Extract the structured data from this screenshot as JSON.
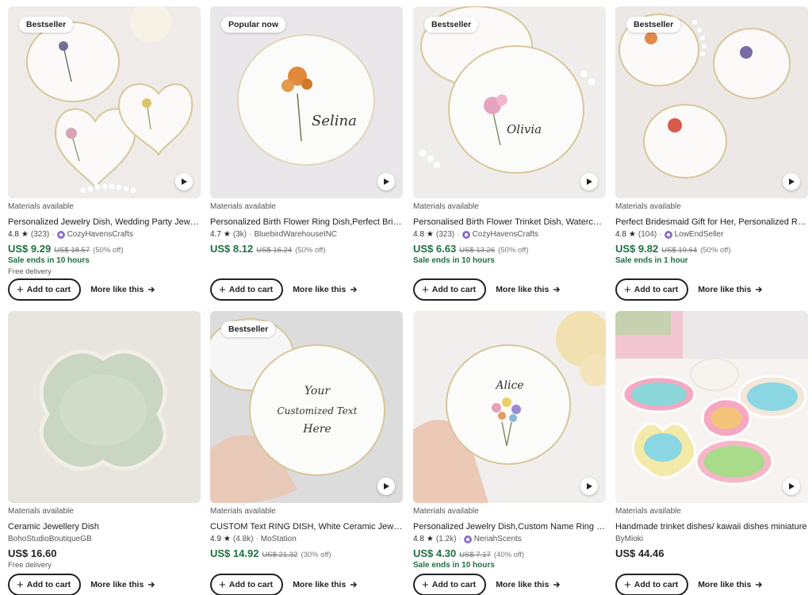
{
  "common": {
    "add_to_cart": "Add to cart",
    "more_like_this": "More like this"
  },
  "products": [
    {
      "badge": "Bestseller",
      "materials": "Materials available",
      "title": "Personalized Jewelry Dish, Wedding Party Jewelry Dish",
      "rating": "4.8",
      "reviews": "(323)",
      "shop": "CozyHavensCrafts",
      "star_seller": true,
      "price": "US$ 9.29",
      "original": "US$ 18.57",
      "discount": "(50% off)",
      "sale": "Sale ends in 10 hours",
      "delivery": "Free delivery",
      "video": true
    },
    {
      "badge": "Popular now",
      "materials": "Materials available",
      "title": "Personalized Birth Flower Ring Dish,Perfect Bridesmaid Gift",
      "rating": "4.7",
      "reviews": "(3k)",
      "shop": "BluebirdWarehouseINC",
      "star_seller": false,
      "price": "US$ 8.12",
      "original": "US$ 16.24",
      "discount": "(50% off)",
      "sale": "",
      "delivery": "",
      "video": true
    },
    {
      "badge": "Bestseller",
      "materials": "Materials available",
      "title": "Personalised Birth Flower Trinket Dish, Watercolor Ring Dish",
      "rating": "4.8",
      "reviews": "(323)",
      "shop": "CozyHavensCrafts",
      "star_seller": true,
      "price": "US$ 6.63",
      "original": "US$ 13.26",
      "discount": "(50% off)",
      "sale": "Sale ends in 10 hours",
      "delivery": "",
      "video": true
    },
    {
      "badge": "Bestseller",
      "materials": "Materials available",
      "title": "Perfect Bridesmaid Gift for Her, Personalized Ring Dish",
      "rating": "4.8",
      "reviews": "(104)",
      "shop": "LowEndSeller",
      "star_seller": true,
      "price": "US$ 9.82",
      "original": "US$ 19.64",
      "discount": "(50% off)",
      "sale": "Sale ends in 1 hour",
      "delivery": "",
      "video": true
    },
    {
      "badge": "",
      "materials": "Materials available",
      "title": "Ceramic Jewellery Dish",
      "rating": "",
      "reviews": "",
      "shop": "BohoStudioBoutiqueGB",
      "star_seller": false,
      "price": "US$ 16.60",
      "original": "",
      "discount": "",
      "sale": "",
      "delivery": "Free delivery",
      "video": false
    },
    {
      "badge": "Bestseller",
      "materials": "Materials available",
      "title": "CUSTOM Text RING DISH, White Ceramic Jewelry Dish",
      "rating": "4.9",
      "reviews": "(4.8k)",
      "shop": "MoStation",
      "star_seller": false,
      "price": "US$ 14.92",
      "original": "US$ 21.32",
      "discount": "(30% off)",
      "sale": "",
      "delivery": "",
      "video": true
    },
    {
      "badge": "",
      "materials": "Materials available",
      "title": "Personalized Jewelry Dish,Custom Name Ring Dish",
      "rating": "4.8",
      "reviews": "(1.2k)",
      "shop": "NeriahScents",
      "star_seller": true,
      "price": "US$ 4.30",
      "original": "US$ 7.17",
      "discount": "(40% off)",
      "sale": "Sale ends in 10 hours",
      "delivery": "",
      "video": true
    },
    {
      "badge": "",
      "materials": "Materials available",
      "title": "Handmade trinket dishes/ kawaii dishes miniature",
      "rating": "",
      "reviews": "",
      "shop": "ByMioki",
      "star_seller": false,
      "price": "US$ 44.46",
      "original": "",
      "discount": "",
      "sale": "",
      "delivery": "",
      "video": true
    }
  ],
  "colors": {
    "price_sale": "#1f6f43",
    "star_seller_badge": "#8a6fd1"
  }
}
